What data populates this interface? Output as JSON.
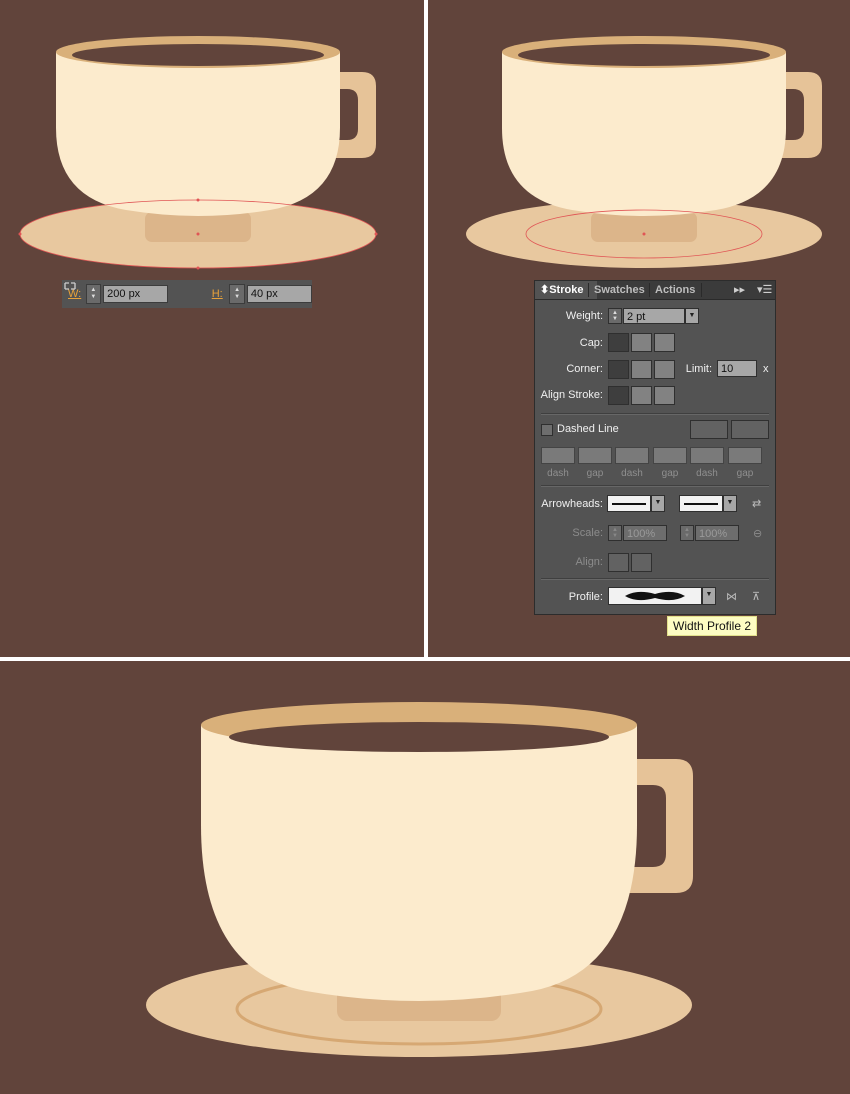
{
  "transform_bar": {
    "w_label": "W:",
    "w_value": "200 px",
    "h_label": "H:",
    "h_value": "40 px",
    "link_icon": "link-icon"
  },
  "stroke_panel": {
    "tabs": [
      "Stroke",
      "Swatches",
      "Actions"
    ],
    "weight_label": "Weight:",
    "weight_value": "2 pt",
    "cap_label": "Cap:",
    "corner_label": "Corner:",
    "limit_label": "Limit:",
    "limit_value": "10",
    "limit_unit": "x",
    "align_stroke_label": "Align Stroke:",
    "dashed_line_label": "Dashed Line",
    "dash_labels": [
      "dash",
      "gap",
      "dash",
      "gap",
      "dash",
      "gap"
    ],
    "arrowheads_label": "Arrowheads:",
    "scale_label": "Scale:",
    "scale_start": "100%",
    "scale_end": "100%",
    "align_label": "Align:",
    "profile_label": "Profile:"
  },
  "tooltip": {
    "text": "Width Profile 2"
  },
  "colors": {
    "background": "#61443b",
    "cup_body": "#fcebcd",
    "cup_rim": "#d9b07a",
    "handle": "#e6c398",
    "saucer": "#e8c89f",
    "selection": "#e05555"
  }
}
